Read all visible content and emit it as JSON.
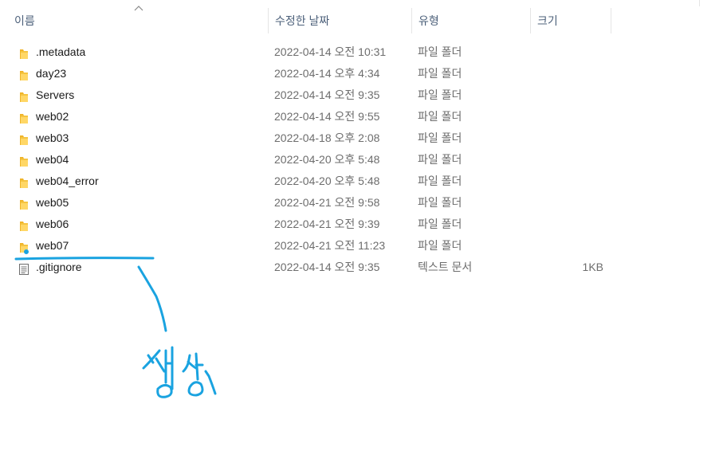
{
  "columns": {
    "name": "이름",
    "modified": "수정한 날짜",
    "type": "유형",
    "size": "크기"
  },
  "files": [
    {
      "name": ".metadata",
      "modified": "2022-04-14 오전 10:31",
      "type": "파일 폴더",
      "size": "",
      "icon": "folder-icon"
    },
    {
      "name": "day23",
      "modified": "2022-04-14 오후 4:34",
      "type": "파일 폴더",
      "size": "",
      "icon": "folder-icon"
    },
    {
      "name": "Servers",
      "modified": "2022-04-14 오전 9:35",
      "type": "파일 폴더",
      "size": "",
      "icon": "folder-icon"
    },
    {
      "name": "web02",
      "modified": "2022-04-14 오전 9:55",
      "type": "파일 폴더",
      "size": "",
      "icon": "folder-icon"
    },
    {
      "name": "web03",
      "modified": "2022-04-18 오후 2:08",
      "type": "파일 폴더",
      "size": "",
      "icon": "folder-icon"
    },
    {
      "name": "web04",
      "modified": "2022-04-20 오후 5:48",
      "type": "파일 폴더",
      "size": "",
      "icon": "folder-icon"
    },
    {
      "name": "web04_error",
      "modified": "2022-04-20 오후 5:48",
      "type": "파일 폴더",
      "size": "",
      "icon": "folder-icon"
    },
    {
      "name": "web05",
      "modified": "2022-04-21 오전 9:58",
      "type": "파일 폴더",
      "size": "",
      "icon": "folder-icon"
    },
    {
      "name": "web06",
      "modified": "2022-04-21 오전 9:39",
      "type": "파일 폴더",
      "size": "",
      "icon": "folder-icon"
    },
    {
      "name": "web07",
      "modified": "2022-04-21 오전 11:23",
      "type": "파일 폴더",
      "size": "",
      "icon": "folder-icon"
    },
    {
      "name": ".gitignore",
      "modified": "2022-04-14 오전 9:35",
      "type": "텍스트 문서",
      "size": "1KB",
      "icon": "text-document-icon"
    }
  ],
  "annotation": {
    "handwritten_text": "생성",
    "color": "#1aa3e0"
  },
  "colors": {
    "header_text": "#4c607a",
    "folder": "#f5c440",
    "secondary_text": "#6d6d6d"
  }
}
